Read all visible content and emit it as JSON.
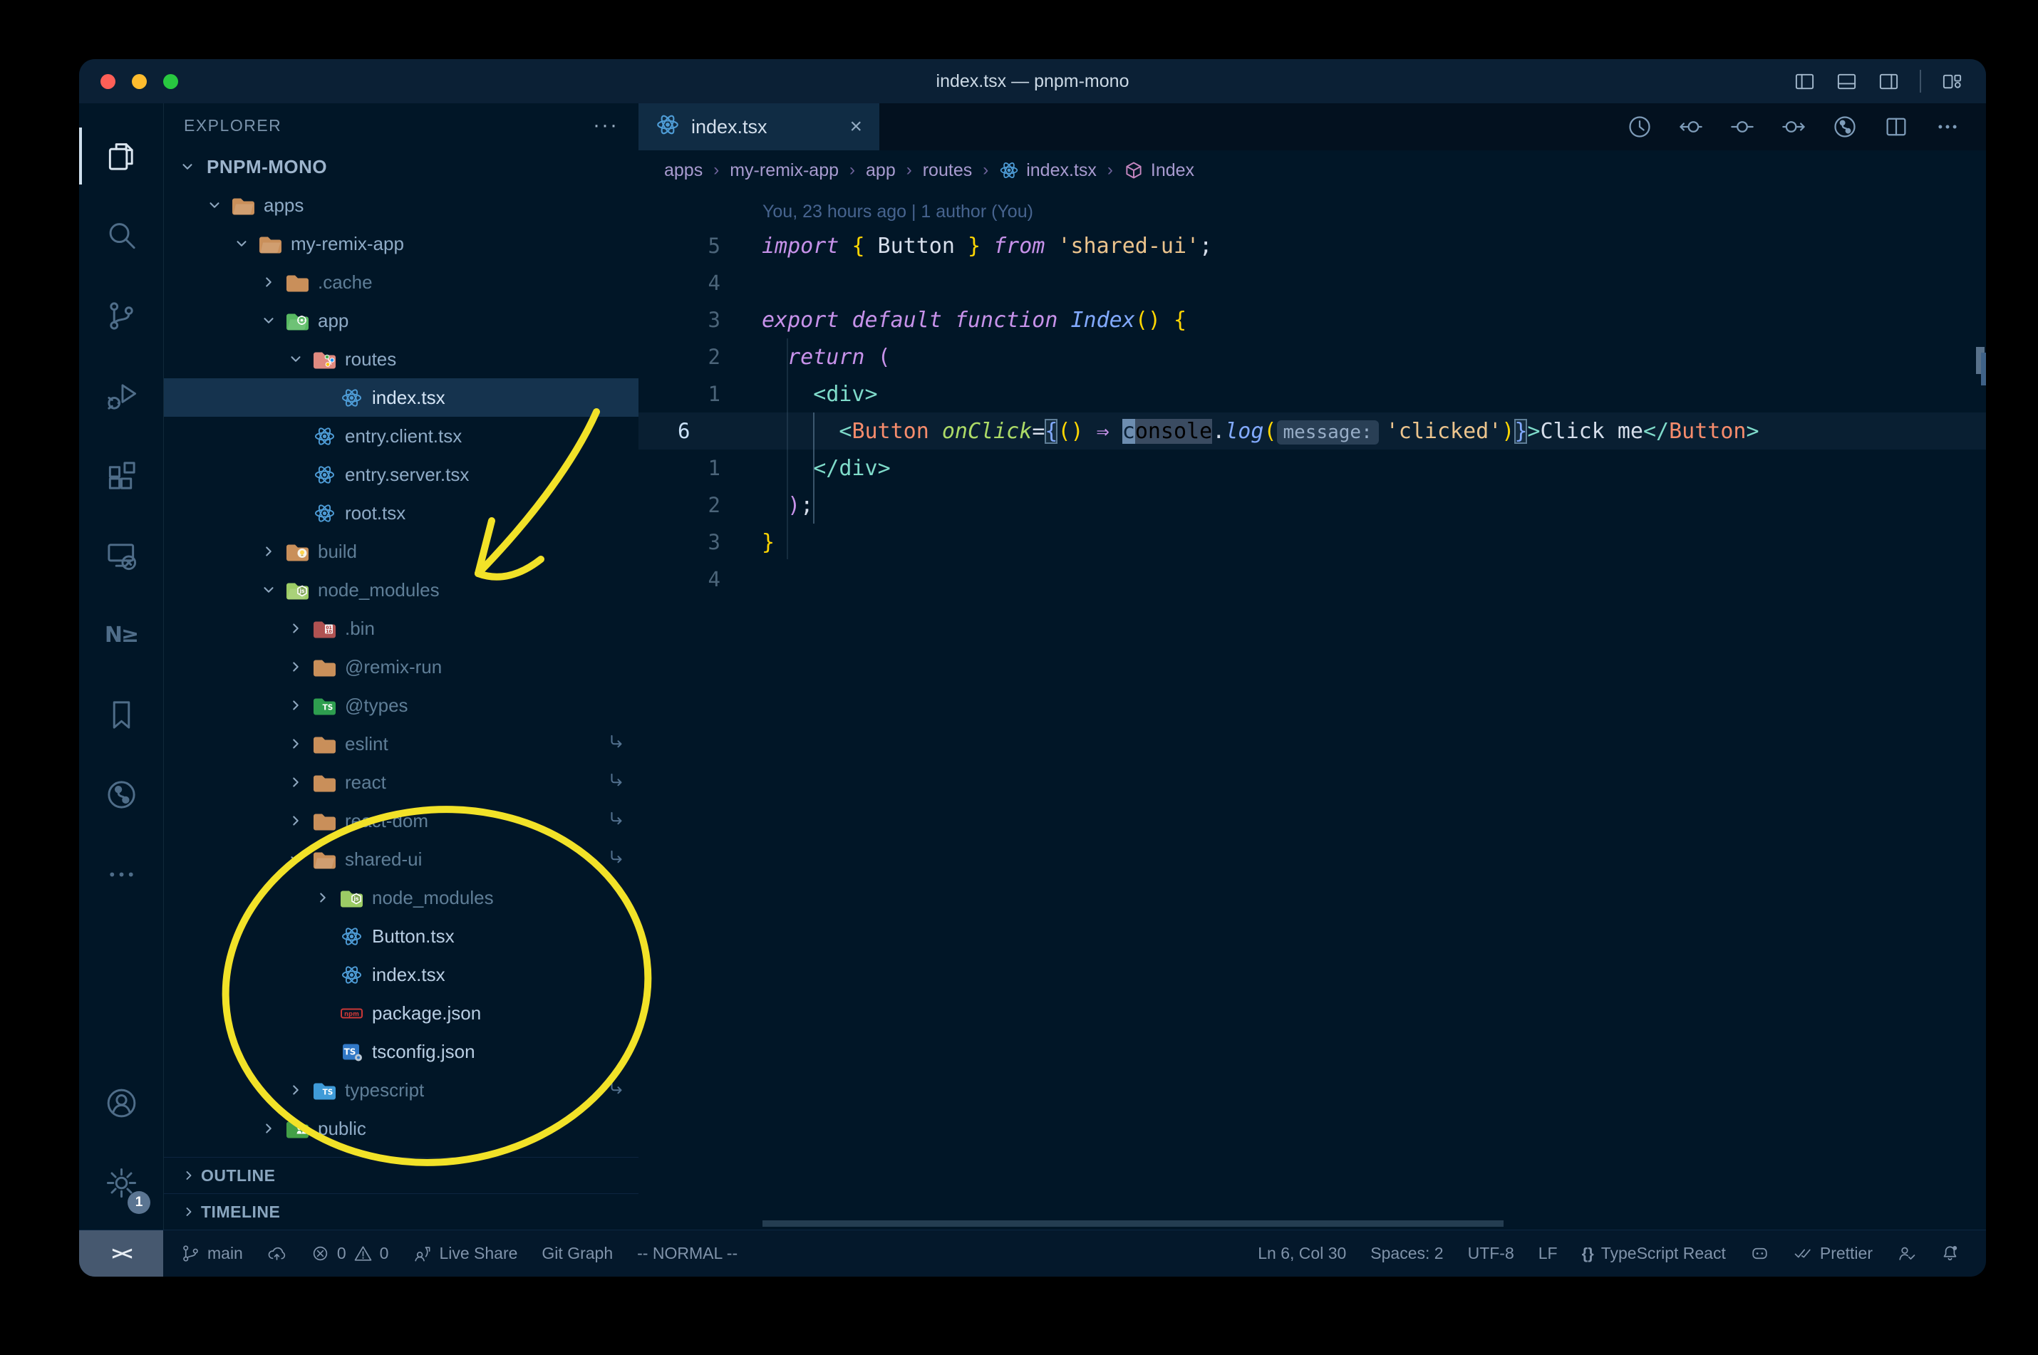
{
  "window": {
    "title": "index.tsx — pnpm-mono"
  },
  "titlebar": {
    "icons": [
      "layout-sidebar-left-icon",
      "layout-panel-icon",
      "layout-sidebar-right-icon",
      "layout-customize-icon"
    ]
  },
  "activity_bar": {
    "top": [
      {
        "name": "explorer",
        "icon": "files-icon",
        "active": true
      },
      {
        "name": "search",
        "icon": "search-icon"
      },
      {
        "name": "source-control",
        "icon": "source-control-icon"
      },
      {
        "name": "run-debug",
        "icon": "debug-icon"
      },
      {
        "name": "extensions",
        "icon": "extensions-icon"
      },
      {
        "name": "remote-explorer",
        "icon": "remote-icon"
      },
      {
        "name": "nx-console",
        "icon": "nx-icon"
      },
      {
        "name": "bookmarks",
        "icon": "bookmark-icon"
      },
      {
        "name": "gitlens",
        "icon": "gitlens-icon"
      },
      {
        "name": "more-views",
        "icon": "ellipsis-icon"
      }
    ],
    "bottom": [
      {
        "name": "accounts",
        "icon": "account-icon"
      },
      {
        "name": "settings",
        "icon": "gear-icon",
        "badge": "1"
      }
    ]
  },
  "explorer": {
    "header": "EXPLORER",
    "root_label": "PNPM-MONO",
    "tree": [
      {
        "label": "apps",
        "level": 1,
        "chevron": "open",
        "icon": "folder-open-tan"
      },
      {
        "label": "my-remix-app",
        "level": 2,
        "chevron": "open",
        "icon": "folder-open-tan"
      },
      {
        "label": ".cache",
        "level": 3,
        "chevron": "closed",
        "icon": "folder-tan",
        "dim": true
      },
      {
        "label": "app",
        "level": 3,
        "chevron": "open",
        "icon": "folder-app"
      },
      {
        "label": "routes",
        "level": 4,
        "chevron": "open",
        "icon": "folder-routes"
      },
      {
        "label": "index.tsx",
        "level": 5,
        "icon": "react-icon",
        "selected": true,
        "bright": true
      },
      {
        "label": "entry.client.tsx",
        "level": 4,
        "icon": "react-icon"
      },
      {
        "label": "entry.server.tsx",
        "level": 4,
        "icon": "react-icon"
      },
      {
        "label": "root.tsx",
        "level": 4,
        "icon": "react-icon"
      },
      {
        "label": "build",
        "level": 3,
        "chevron": "closed",
        "icon": "folder-build",
        "dim": true
      },
      {
        "label": "node_modules",
        "level": 3,
        "chevron": "open",
        "icon": "folder-node-open",
        "dim": true
      },
      {
        "label": ".bin",
        "level": 4,
        "chevron": "closed",
        "icon": "folder-bin",
        "dim": true
      },
      {
        "label": "@remix-run",
        "level": 4,
        "chevron": "closed",
        "icon": "folder-tan",
        "dim": true
      },
      {
        "label": "@types",
        "level": 4,
        "chevron": "closed",
        "icon": "folder-types",
        "dim": true
      },
      {
        "label": "eslint",
        "level": 4,
        "chevron": "closed",
        "icon": "folder-tan",
        "dim": true,
        "symlink": true
      },
      {
        "label": "react",
        "level": 4,
        "chevron": "closed",
        "icon": "folder-tan",
        "dim": true,
        "symlink": true
      },
      {
        "label": "react-dom",
        "level": 4,
        "chevron": "closed",
        "icon": "folder-tan",
        "dim": true,
        "symlink": true
      },
      {
        "label": "shared-ui",
        "level": 4,
        "chevron": "open",
        "icon": "folder-open-tan",
        "dim": true,
        "symlink": true
      },
      {
        "label": "node_modules",
        "level": 5,
        "chevron": "closed",
        "icon": "folder-node",
        "dim": true
      },
      {
        "label": "Button.tsx",
        "level": 5,
        "icon": "react-icon",
        "bright": true
      },
      {
        "label": "index.tsx",
        "level": 5,
        "icon": "react-icon",
        "bright": true
      },
      {
        "label": "package.json",
        "level": 5,
        "icon": "npm-icon",
        "bright": true
      },
      {
        "label": "tsconfig.json",
        "level": 5,
        "icon": "tsconfig-icon",
        "bright": true
      },
      {
        "label": "typescript",
        "level": 4,
        "chevron": "closed",
        "icon": "folder-ts",
        "dim": true,
        "symlink": true
      },
      {
        "label": "public",
        "level": 3,
        "chevron": "closed",
        "icon": "folder-public"
      }
    ],
    "sections": [
      "OUTLINE",
      "TIMELINE"
    ]
  },
  "tabs": [
    {
      "label": "index.tsx",
      "icon": "react-icon",
      "active": true
    }
  ],
  "editor_actions": [
    "history-clock-icon",
    "nav-back-icon",
    "nav-current-icon",
    "nav-forward-icon",
    "gitlens-icon",
    "split-editor-icon",
    "more-icon"
  ],
  "breadcrumbs": [
    {
      "label": "apps"
    },
    {
      "label": "my-remix-app"
    },
    {
      "label": "app"
    },
    {
      "label": "routes"
    },
    {
      "label": "index.tsx",
      "icon": "react-icon"
    },
    {
      "label": "Index",
      "icon": "symbol-class-icon"
    }
  ],
  "editor": {
    "blame": "You, 23 hours ago | 1 author (You)",
    "lines": [
      {
        "num": "5",
        "tokens": [
          [
            "import",
            "kw"
          ],
          [
            " ",
            "pl"
          ],
          [
            "{",
            "gold"
          ],
          [
            " Button ",
            "pl"
          ],
          [
            "}",
            "gold"
          ],
          [
            " ",
            "pl"
          ],
          [
            "from",
            "kw"
          ],
          [
            " ",
            "pl"
          ],
          [
            "'shared-ui'",
            "str"
          ],
          [
            ";",
            "pl"
          ]
        ]
      },
      {
        "num": "4",
        "tokens": []
      },
      {
        "num": "3",
        "tokens": [
          [
            "export",
            "kw"
          ],
          [
            " ",
            "pl"
          ],
          [
            "default",
            "kw"
          ],
          [
            " ",
            "pl"
          ],
          [
            "function",
            "kw"
          ],
          [
            " ",
            "pl"
          ],
          [
            "Index",
            "fn"
          ],
          [
            "(",
            "gold"
          ],
          [
            ")",
            "gold"
          ],
          [
            " ",
            "pl"
          ],
          [
            "{",
            "gold"
          ]
        ]
      },
      {
        "num": "2",
        "tokens": [
          [
            "  ",
            "pl"
          ],
          [
            "return",
            "kw"
          ],
          [
            " ",
            "pl"
          ],
          [
            "(",
            "pink"
          ]
        ]
      },
      {
        "num": "1",
        "tokens": [
          [
            "    ",
            "pl"
          ],
          [
            "<",
            "tag"
          ],
          [
            "div",
            "tag"
          ],
          [
            ">",
            "tag"
          ]
        ]
      },
      {
        "num": "6",
        "current": true,
        "tokens": [
          [
            "      ",
            "pl"
          ],
          [
            "<",
            "tag"
          ],
          [
            "Button",
            "comp"
          ],
          [
            " ",
            "pl"
          ],
          [
            "onClick",
            "attr"
          ],
          [
            "=",
            "pl"
          ],
          [
            "{",
            "jsxbm"
          ],
          [
            "(",
            "gold"
          ],
          [
            ")",
            "gold"
          ],
          [
            " ",
            "pl"
          ],
          [
            "⇒",
            "pink"
          ],
          [
            " ",
            "pl"
          ],
          [
            "c",
            "cursor"
          ],
          [
            "onsole",
            "wordhl"
          ],
          [
            ".",
            "pl"
          ],
          [
            "log",
            "fn"
          ],
          [
            "(",
            "gold"
          ],
          [
            "message:",
            "inlay"
          ],
          [
            "'clicked'",
            "str"
          ],
          [
            ")",
            "gold"
          ],
          [
            "}",
            "jsxbm"
          ],
          [
            ">",
            "tag"
          ],
          [
            "Click me",
            "pl"
          ],
          [
            "</",
            "tag"
          ],
          [
            "Button",
            "comp"
          ],
          [
            ">",
            "tag"
          ]
        ]
      },
      {
        "num": "1",
        "tokens": [
          [
            "    ",
            "pl"
          ],
          [
            "</",
            "tag"
          ],
          [
            "div",
            "tag"
          ],
          [
            ">",
            "tag"
          ]
        ]
      },
      {
        "num": "2",
        "tokens": [
          [
            "  ",
            "pl"
          ],
          [
            ")",
            "pink"
          ],
          [
            ";",
            "pl"
          ]
        ]
      },
      {
        "num": "3",
        "tokens": [
          [
            "}",
            "gold"
          ]
        ]
      },
      {
        "num": "4",
        "tokens": []
      }
    ]
  },
  "status_bar": {
    "remote_indicator": "><",
    "left": [
      {
        "name": "git-branch",
        "parts": [
          {
            "icon": "branch-icon"
          },
          {
            "text": "main"
          }
        ]
      },
      {
        "name": "publish",
        "parts": [
          {
            "icon": "cloud-upload-icon"
          }
        ]
      },
      {
        "name": "problems",
        "parts": [
          {
            "icon": "error-icon"
          },
          {
            "text": "0"
          },
          {
            "icon": "warning-icon"
          },
          {
            "text": "0"
          }
        ]
      },
      {
        "name": "live-share",
        "parts": [
          {
            "icon": "live-share-icon"
          },
          {
            "text": "Live Share"
          }
        ]
      },
      {
        "name": "git-graph",
        "parts": [
          {
            "text": "Git Graph"
          }
        ]
      },
      {
        "name": "vim-mode",
        "parts": [
          {
            "text": "-- NORMAL --"
          }
        ]
      }
    ],
    "right": [
      {
        "name": "cursor-position",
        "parts": [
          {
            "text": "Ln 6, Col 30"
          }
        ]
      },
      {
        "name": "indentation",
        "parts": [
          {
            "text": "Spaces: 2"
          }
        ]
      },
      {
        "name": "encoding",
        "parts": [
          {
            "text": "UTF-8"
          }
        ]
      },
      {
        "name": "eol",
        "parts": [
          {
            "text": "LF"
          }
        ]
      },
      {
        "name": "language-mode",
        "parts": [
          {
            "text": "{}",
            "cls": "sb-braces"
          },
          {
            "text": "TypeScript React"
          }
        ]
      },
      {
        "name": "copilot",
        "parts": [
          {
            "icon": "copilot-icon"
          }
        ]
      },
      {
        "name": "prettier",
        "parts": [
          {
            "icon": "double-check-icon"
          },
          {
            "text": "Prettier"
          }
        ]
      },
      {
        "name": "person",
        "parts": [
          {
            "icon": "person-check-icon"
          }
        ]
      },
      {
        "name": "notifications",
        "parts": [
          {
            "icon": "bell-dot-icon"
          }
        ]
      }
    ]
  },
  "annotations": {
    "color": "#f2e228",
    "arrow_target": "node_modules",
    "ellipse_target": "shared-ui package contents"
  },
  "colors": {
    "window_bg": "#011627",
    "titlebar_bg": "#0b2035",
    "tab_active_bg": "#102c44",
    "selected_row": "#15334e",
    "dim_text": "#5f7e97",
    "keyword": "#c792ea",
    "string": "#ecc48d",
    "function": "#82aaff",
    "component": "#f78c6c",
    "attribute": "#addb67",
    "tag": "#7fdbca",
    "gold": "#ffd602",
    "annotation_yellow": "#f2e228"
  }
}
